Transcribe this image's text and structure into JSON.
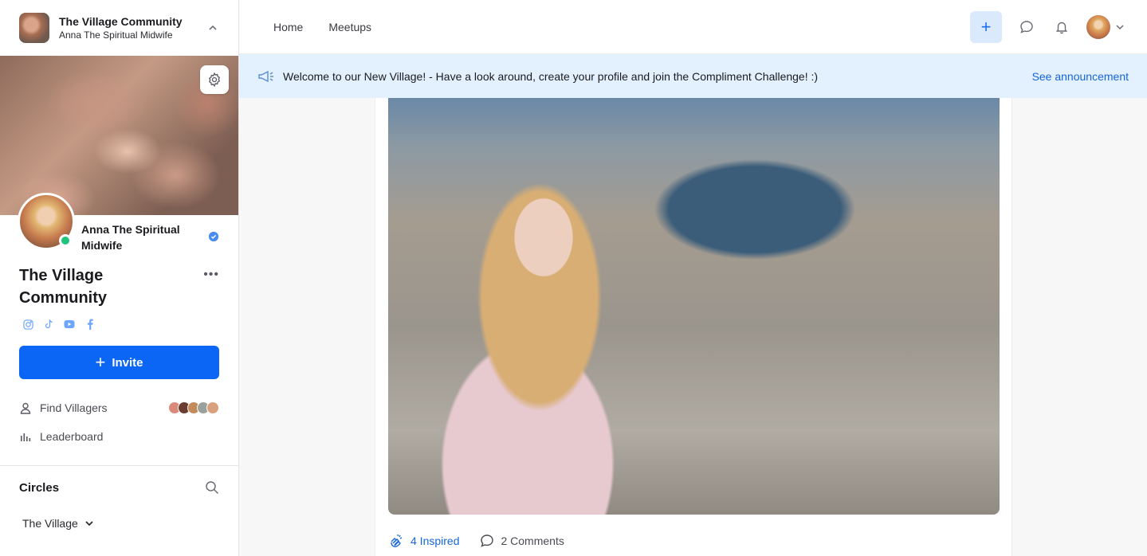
{
  "sidebar": {
    "community_name": "The Village Community",
    "community_subtitle": "Anna The Spiritual Midwife",
    "profile_name": "Anna The Spiritual Midwife",
    "community_title": "The Village Community",
    "more_label": "•••",
    "invite_label": "Invite",
    "nav": [
      {
        "label": "Find Villagers",
        "icon": "user-icon"
      },
      {
        "label": "Leaderboard",
        "icon": "bar-chart-icon"
      }
    ],
    "socials": [
      "instagram-icon",
      "tiktok-icon",
      "youtube-icon",
      "facebook-icon"
    ],
    "circles_title": "Circles",
    "circle_item": "The Village"
  },
  "topbar": {
    "nav": [
      "Home",
      "Meetups"
    ],
    "add_label": "+"
  },
  "announcement": {
    "text": "Welcome to our New Village! - Have a look around, create your profile and join the Compliment Challenge! :)",
    "link": "See announcement"
  },
  "post": {
    "reactions_label": "4 Inspired",
    "comments_label": "2 Comments"
  },
  "colors": {
    "accent": "#0b66f5",
    "announcement_bg": "#e3f0fd",
    "online": "#1fc47a"
  }
}
